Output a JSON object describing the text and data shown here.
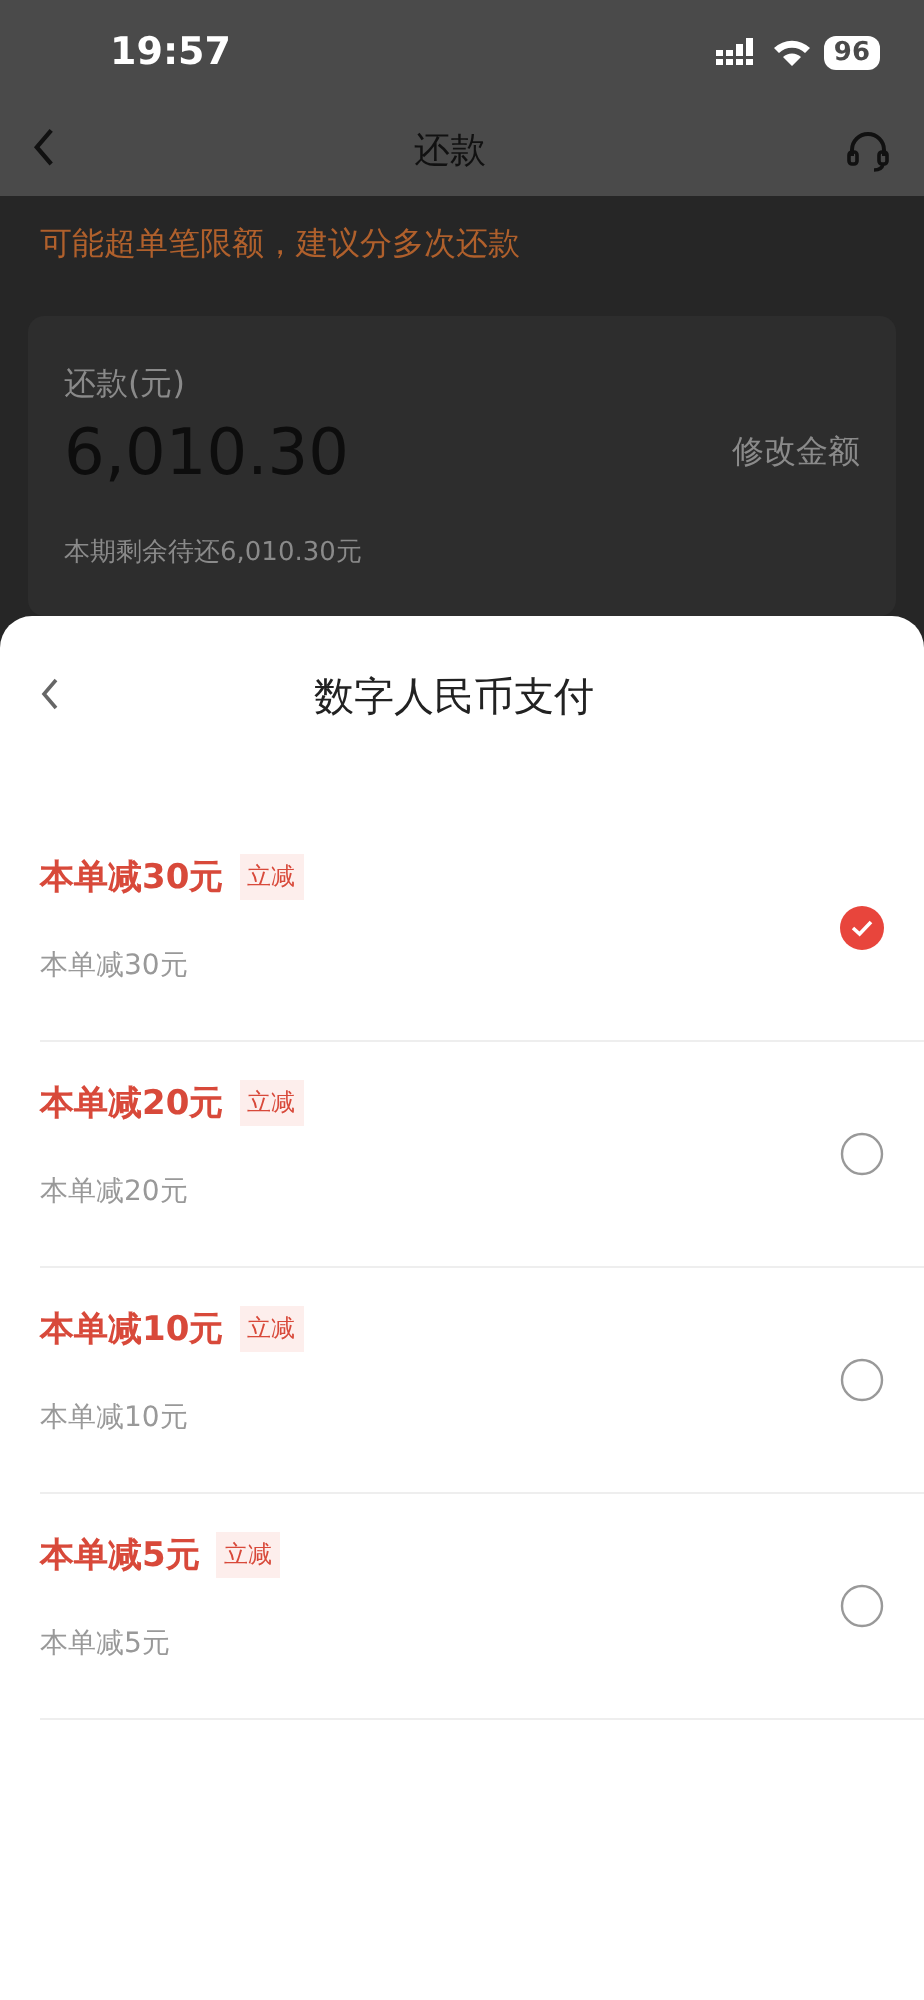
{
  "status_bar": {
    "time": "19:57",
    "battery": "96"
  },
  "nav": {
    "title": "还款"
  },
  "warning": "可能超单笔限额，建议分多次还款",
  "amount_card": {
    "label": "还款(元)",
    "amount": "6,010.30",
    "edit_link": "修改金额",
    "remaining": "本期剩余待还6,010.30元"
  },
  "sheet": {
    "title": "数字人民币支付",
    "options": [
      {
        "title": "本单减30元",
        "tag": "立减",
        "subtitle": "本单减30元",
        "selected": true
      },
      {
        "title": "本单减20元",
        "tag": "立减",
        "subtitle": "本单减20元",
        "selected": false
      },
      {
        "title": "本单减10元",
        "tag": "立减",
        "subtitle": "本单减10元",
        "selected": false
      },
      {
        "title": "本单减5元",
        "tag": "立减",
        "subtitle": "本单减5元",
        "selected": false
      }
    ]
  }
}
